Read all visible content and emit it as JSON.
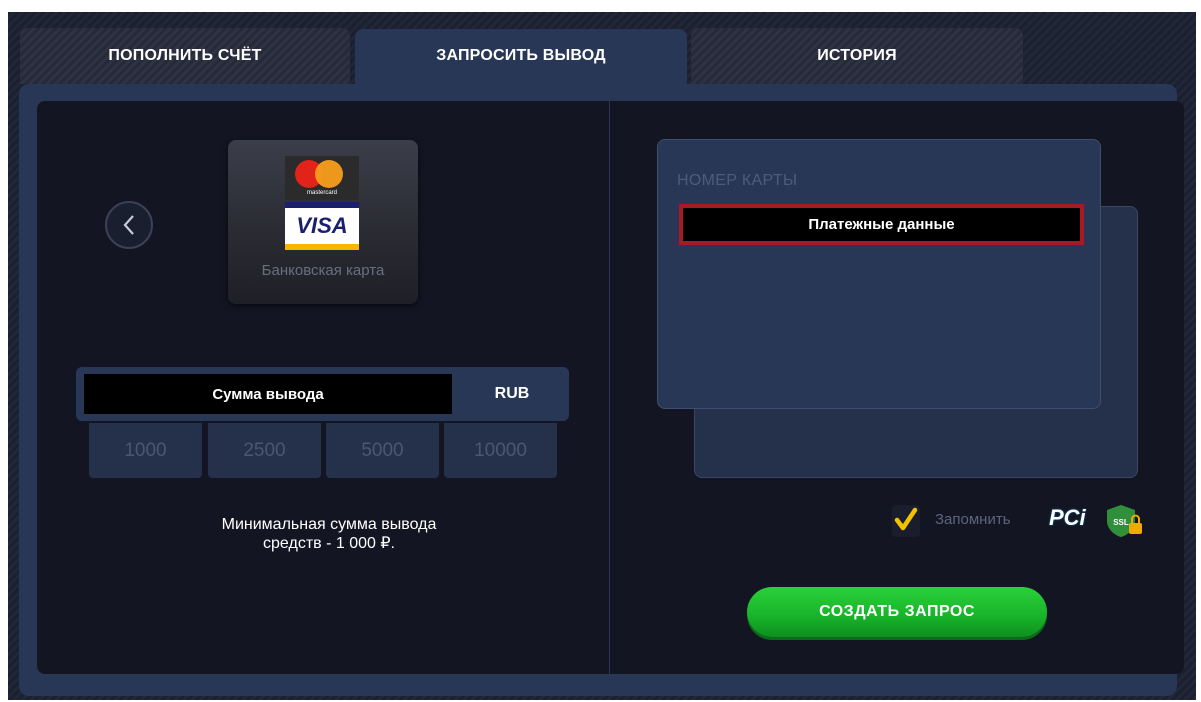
{
  "tabs": [
    {
      "label": "ПОПОЛНИТЬ СЧЁТ",
      "active": false
    },
    {
      "label": "ЗАПРОСИТЬ ВЫВОД",
      "active": true
    },
    {
      "label": "ИСТОРИЯ",
      "active": false
    }
  ],
  "method": {
    "prev_icon": "chevron-left-icon",
    "logo_mastercard_text": "mastercard",
    "logo_visa_text": "VISA",
    "label": "Банковская карта"
  },
  "amount": {
    "placeholder": "Сумма вывода",
    "currency": "RUB",
    "presets": [
      "1000",
      "2500",
      "5000",
      "10000"
    ],
    "min_note_line1": "Минимальная сумма вывода",
    "min_note_line2": "средств - 1 000 ₽."
  },
  "card": {
    "number_label": "НОМЕР КАРТЫ",
    "number_placeholder": "Платежные данные"
  },
  "remember": {
    "label": "Запомнить",
    "checked": true
  },
  "badges": {
    "pci_text": "PCi",
    "ssl_text": "SSL"
  },
  "submit_label": "СОЗДАТЬ ЗАПРОС",
  "colors": {
    "accent_green": "#18b22a",
    "panel": "#283755",
    "highlight_red": "#a61b23"
  }
}
